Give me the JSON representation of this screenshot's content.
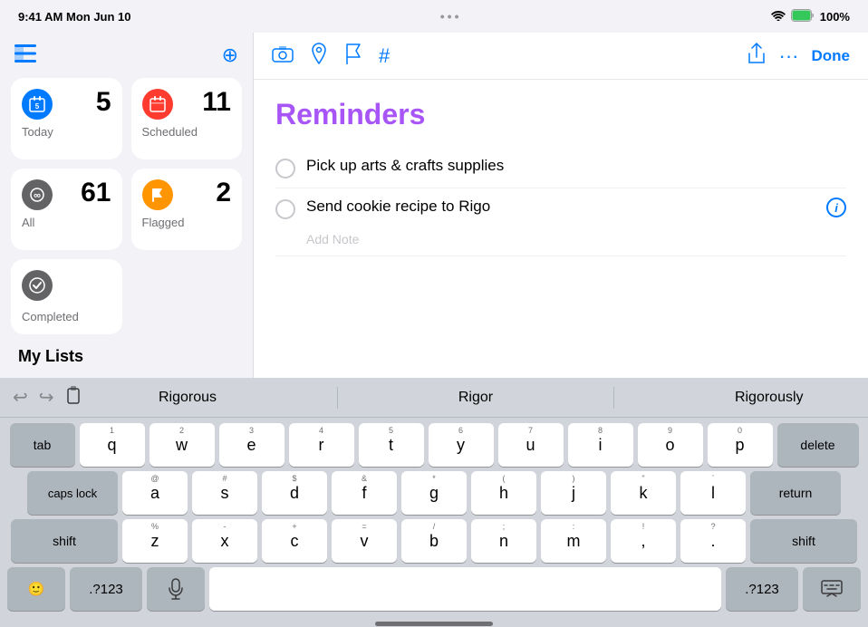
{
  "statusBar": {
    "time": "9:41 AM",
    "date": "Mon Jun 10",
    "dots": "•••",
    "wifi": "WiFi",
    "battery": "100%"
  },
  "sidebar": {
    "sidebarToggleIcon": "sidebar",
    "moreIcon": "ellipsis.circle",
    "smartLists": [
      {
        "id": "today",
        "label": "Today",
        "count": "5",
        "iconColor": "blue",
        "iconSymbol": "📅"
      },
      {
        "id": "scheduled",
        "label": "Scheduled",
        "count": "11",
        "iconColor": "red",
        "iconSymbol": "📅"
      },
      {
        "id": "all",
        "label": "All",
        "count": "61",
        "iconColor": "dark",
        "iconSymbol": "∞"
      },
      {
        "id": "flagged",
        "label": "Flagged",
        "count": "2",
        "iconColor": "orange",
        "iconSymbol": "⚑"
      }
    ],
    "completed": {
      "label": "Completed",
      "iconColor": "dark",
      "iconSymbol": "✓"
    },
    "myListsHeader": "My Lists"
  },
  "mainContent": {
    "toolbar": {
      "icons": [
        "camera",
        "location",
        "flag",
        "hash"
      ],
      "shareIcon": "share",
      "moreIcon": "ellipsis.circle",
      "doneLabel": "Done"
    },
    "title": "Reminders",
    "reminders": [
      {
        "id": 1,
        "text": "Pick up arts & crafts supplies",
        "hasInfo": false,
        "note": ""
      },
      {
        "id": 2,
        "text": "Send cookie recipe to Rigo",
        "hasInfo": true,
        "note": "Add Note"
      }
    ]
  },
  "keyboard": {
    "autocomplete": {
      "suggestions": [
        "Rigorous",
        "Rigor",
        "Rigorously"
      ]
    },
    "rows": [
      {
        "keys": [
          {
            "label": "q",
            "num": "1"
          },
          {
            "label": "w",
            "num": "2"
          },
          {
            "label": "e",
            "num": "3"
          },
          {
            "label": "r",
            "num": "4"
          },
          {
            "label": "t",
            "num": "5"
          },
          {
            "label": "y",
            "num": "6"
          },
          {
            "label": "u",
            "num": "7"
          },
          {
            "label": "i",
            "num": "8"
          },
          {
            "label": "o",
            "num": "9"
          },
          {
            "label": "p",
            "num": "0"
          }
        ],
        "leftSpecial": {
          "label": "tab"
        },
        "rightSpecial": {
          "label": "delete"
        }
      },
      {
        "keys": [
          {
            "label": "a",
            "num": "@"
          },
          {
            "label": "s",
            "num": "#"
          },
          {
            "label": "d",
            "num": "$"
          },
          {
            "label": "f",
            "num": "&"
          },
          {
            "label": "g",
            "num": "*"
          },
          {
            "label": "h",
            "num": "("
          },
          {
            "label": "j",
            "num": ")"
          },
          {
            "label": "k",
            "num": "\""
          },
          {
            "label": "l",
            "num": ""
          }
        ],
        "leftSpecial": {
          "label": "caps lock"
        },
        "rightSpecial": {
          "label": "return"
        }
      },
      {
        "keys": [
          {
            "label": "z",
            "num": "%"
          },
          {
            "label": "x",
            "num": "-"
          },
          {
            "label": "c",
            "num": "+"
          },
          {
            "label": "v",
            "num": "="
          },
          {
            "label": "b",
            "num": "/"
          },
          {
            "label": "n",
            "num": ";"
          },
          {
            "label": "m",
            "num": ":"
          },
          {
            "label": ",",
            "num": "!"
          },
          {
            "label": ".",
            "num": "?"
          }
        ],
        "leftSpecial": {
          "label": "shift"
        },
        "rightSpecial": {
          "label": "shift"
        }
      }
    ],
    "bottomRow": {
      "emoji": "🙂",
      "num1": ".?123",
      "mic": "🎙",
      "space": "",
      "num2": ".?123",
      "keyboard": "⌨"
    }
  }
}
